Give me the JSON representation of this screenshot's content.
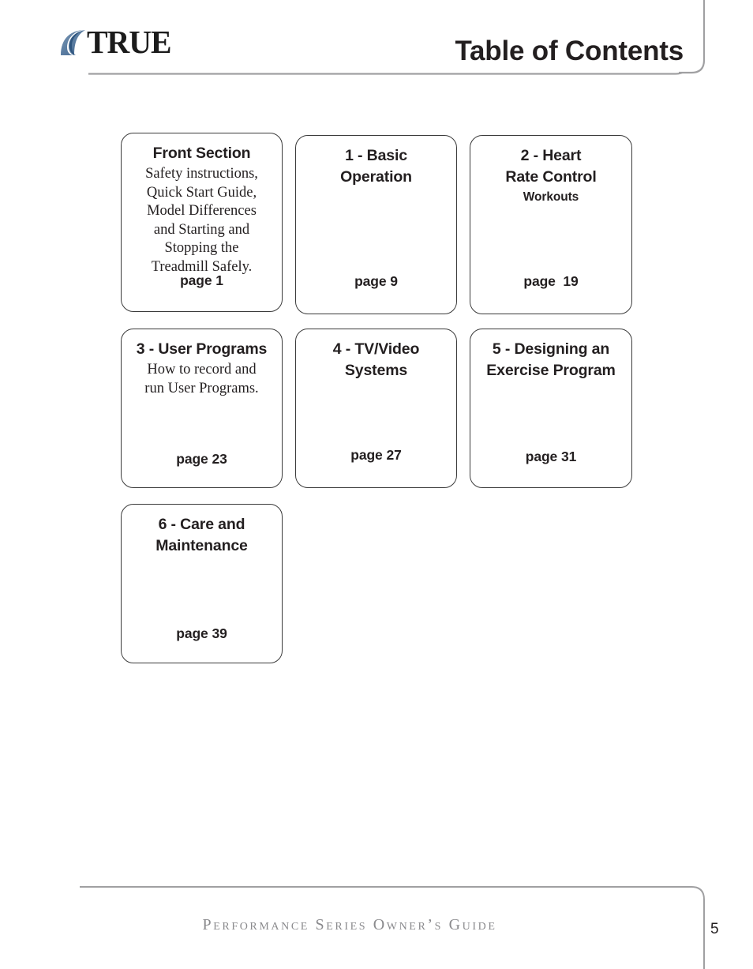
{
  "header": {
    "logo_text": "TRUE",
    "logo_mark": "swoosh-logo-icon",
    "title": "Table of Contents",
    "rule_color": "#a0a0a2"
  },
  "cards": [
    {
      "name": "front-section",
      "heading": "Front Section",
      "subheading": "",
      "body": "Safety instructions,\nQuick Start Guide,\nModel Differences\nand Starting and\nStopping the\nTreadmill Safely.",
      "page": "page 1"
    },
    {
      "name": "basic-operation",
      "heading": "1 - Basic\nOperation",
      "subheading": "",
      "body": "",
      "page": "page 9"
    },
    {
      "name": "heart-rate-control-workouts",
      "heading": "2 - Heart\nRate Control",
      "subheading": "Workouts",
      "body": "",
      "page": "page  19"
    },
    {
      "name": "user-programs",
      "heading": "3 - User Programs",
      "subheading": "",
      "body": "How to record and\nrun User Programs.",
      "page": "page 23"
    },
    {
      "name": "tv-video-systems",
      "heading": "4 - TV/Video\nSystems",
      "subheading": "",
      "body": "",
      "page": "page 27"
    },
    {
      "name": "designing-an-exercise-program",
      "heading": "5 - Designing an\nExercise Program",
      "subheading": "",
      "body": "",
      "page": "page 31"
    },
    {
      "name": "care-and-maintenance",
      "heading": "6 - Care and\nMaintenance",
      "subheading": "",
      "body": "",
      "page": "page 39"
    }
  ],
  "footer": {
    "text": "Performance Series Owner’s Guide",
    "page_number": "5",
    "rule_color": "#a0a0a2"
  }
}
